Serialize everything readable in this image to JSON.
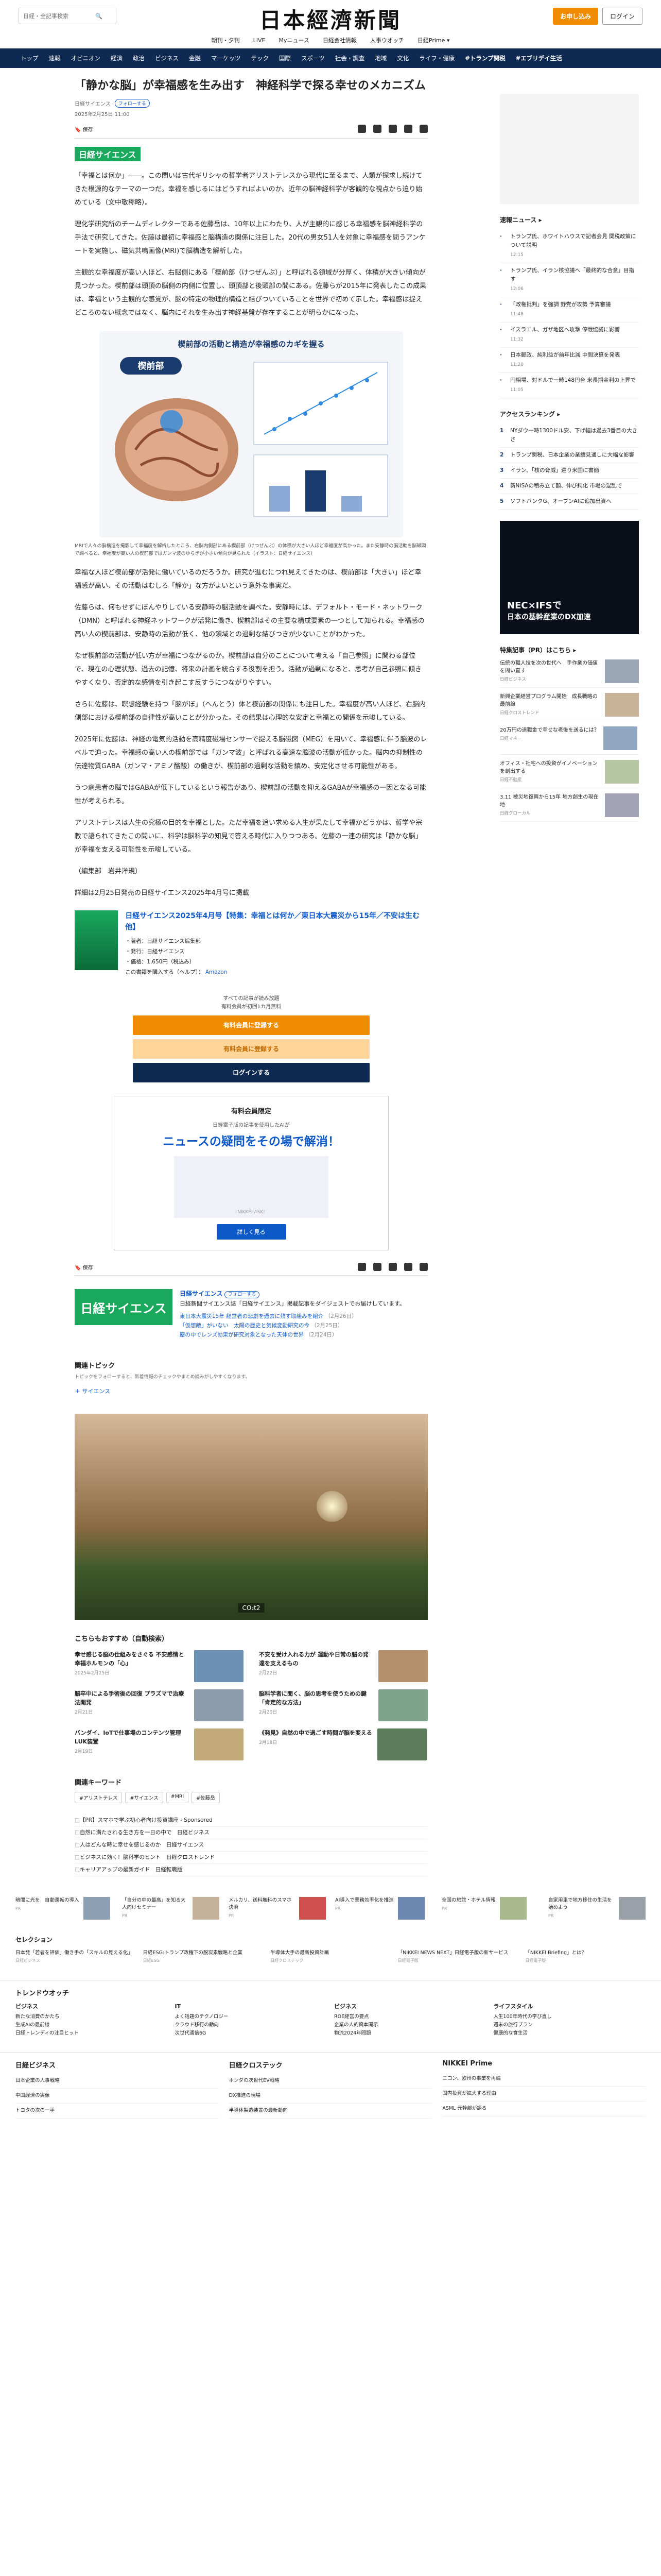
{
  "header": {
    "search_placeholder": "日経・全記事検索",
    "logo": "日本經濟新聞",
    "subscribe_label": "お申し込み",
    "login_label": "ログイン"
  },
  "subnav": [
    "朝刊・夕刊",
    "LIVE",
    "Myニュース",
    "日経会社情報",
    "人事ウオッチ",
    "日経Prime ▾"
  ],
  "mainnav": [
    "トップ",
    "速報",
    "オピニオン",
    "経済",
    "政治",
    "ビジネス",
    "金融",
    "マーケッツ",
    "テック",
    "国際",
    "スポーツ",
    "社会・調査",
    "地域",
    "文化",
    "ライフ・健康",
    "#トランプ関税",
    "#エブリデイ生活"
  ],
  "article": {
    "title": "「静かな脳」が幸福感を生み出す　神経科学で探る幸せのメカニズム",
    "source": "日経サイエンス",
    "follow": "フォローする",
    "date": "2025年2月25日 11:00",
    "save_label": "保存",
    "badge": "日経サイエンス",
    "paragraphs": [
      "「幸福とは何か」――。この問いは古代ギリシャの哲学者アリストテレスから現代に至るまで、人類が探求し続けてきた根源的なテーマの一つだ。幸福を感じるにはどうすればよいのか。近年の脳神経科学が客観的な視点から迫り始めている（文中敬称略）。",
      "理化学研究所のチームディレクターである佐藤岳は、10年以上にわたり、人が主観的に感じる幸福感を脳神経科学の手法で研究してきた。佐藤は最初に幸福感と脳構造の関係に注目した。20代の男女51人を対象に幸福感を問うアンケートを実施し、磁気共鳴画像(MRI)で脳構造を解析した。",
      "主観的な幸福度が高い人ほど、右脳側にある「楔前部（けつぜんぶ）」と呼ばれる領域が分厚く、体積が大きい傾向が見つかった。楔前部は頭頂の脳側の内側に位置し、頭頂部と後頭部の間にある。佐藤らが2015年に発表したこの成果は、幸福という主観的な感覚が、脳の特定の物理的構造と結びついていることを世界で初めて示した。幸福感は捉えどころのない概念ではなく、脳内にそれを生み出す神経基盤が存在することが明らかになった。",
      "幸福な人ほど楔前部が活発に働いているのだろうか。研究が進むにつれ見えてきたのは、楔前部は「大きい」ほど幸福感が高い、その活動はむしろ「静か」な方がよいという意外な事実だ。",
      "佐藤らは、何もせずにぼんやりしている安静時の脳活動を調べた。安静時には、デフォルト・モード・ネットワーク（DMN）と呼ばれる神経ネットワークが活発に働き、楔前部はその主要な構成要素の一つとして知られる。幸福感の高い人の楔前部は、安静時の活動が低く、他の領域との過剰な結びつきが少ないことがわかった。",
      "なぜ楔前部の活動が低い方が幸福につながるのか。楔前部は自分のことについて考える「自己参照」に関わる部位で、現在の心理状態、過去の記憶、将来の計画を統合する役割を担う。活動が過剰になると、思考が自己参照に傾きやすくなり、否定的な感情を引き起こす反すうにつながりやすい。",
      "さらに佐藤は、瞑想経験を持つ「脳がぼ」（へんとう）体と楔前部の関係にも注目した。幸福度が高い人ほど、右脳内側部における楔前部の自律性が高いことが分かった。その結果は心理的な安定と幸福との関係を示唆している。",
      "2025年に佐藤は、神経の電気的活動を高精度磁場センサーで捉える脳磁図（MEG）を用いて、幸福感に伴う脳波のレベルで迫った。幸福感の高い人の楔前部では「ガンマ波」と呼ばれる高速な脳波の活動が低かった。脳内の抑制性の伝達物質GABA（ガンマ・アミノ酪酸）の働きが、楔前部の過剰な活動を鎮め、安定化させる可能性がある。",
      "うつ病患者の脳ではGABAが低下しているという報告があり、楔前部の活動を抑えるGABAが幸福感の一因となる可能性が考えられる。",
      "アリストテレスは人生の究極の目的を幸福とした。ただ幸福を追い求める人生が果たして幸福かどうかは、哲学や宗教で語られてきたこの問いに、科学は脳科学の知見で答える時代に入りつつある。佐藤の一連の研究は「静かな脳」が幸福を支える可能性を示唆している。",
      "（編集部　岩井洋規）"
    ],
    "figure": {
      "title": "楔前部の活動と構造が幸福感のカギを握る",
      "region_label": "楔前部",
      "caption": "MRIで人々の脳構造を撮影して幸福度を解析したところ、右脳内側部にある楔前部（けつぜんぶ）の体積が大きい人ほど幸福度が高かった。また安静時の脳活動を脳磁図で調べると、幸福度が高い人の楔前部ではガンマ波のゆらぎが小さい傾向が見られた（イラスト：日経サイエンス）"
    },
    "detail_link": "詳細は2月25日発売の日経サイエンス2025年4月号に掲載",
    "book": {
      "title": "日経サイエンス2025年4月号【特集：幸福とは何か／東日本大震災から15年／不安は生む他】",
      "lines": [
        "・著者：日経サイエンス編集部",
        "・発行：日経サイエンス",
        "・価格：1,650円（税込み）"
      ],
      "buy": "この書籍を購入する（ヘルプ）：",
      "amazon": "Amazon"
    },
    "paywall": {
      "note1": "すべての記事が読み放題",
      "note2": "有料会員が初回1カ月無料",
      "cta1": "有料会員に登録する",
      "cta2": "有料会員に登録する",
      "cta3": "ログインする"
    },
    "promo": {
      "head": "有料会員限定",
      "sub": "日経電子版の記事を使用したAIが",
      "big": "ニュースの疑問をその場で解消！",
      "img_label": "NIKKEI ASK!",
      "more": "詳しく見る"
    }
  },
  "source_block": {
    "name": "日経サイエンス",
    "follow": "フォローする",
    "desc": "日経新聞サイエンス誌「日経サイエンス」掲載記事をダイジェストでお届けしています。",
    "items": [
      {
        "text": "東日本大震災15年 経営者の悲劇を過去に残す取組みを紹介",
        "date": "（2月26日）"
      },
      {
        "text": "「仮想敵」がいない　太陽の歴史と気候変動研究の今",
        "date": "（2月25日）"
      },
      {
        "text": "塵の中でレンズ効果が研究対象となった天体の世界",
        "date": "（2月24日）"
      }
    ]
  },
  "topic": {
    "title": "関連トピック",
    "sub": "トピックをフォローすると、新着情報のチェックやまとめ読みがしやすくなります。",
    "chip": "＋ サイエンス"
  },
  "video": {
    "caption": "CO₂t2"
  },
  "reco": {
    "title": "こちらもおすすめ（自動検索）",
    "items": [
      {
        "t": "幸せ感じる脳の仕組みをさぐる 不安感情と幸福ホルモンの「心」",
        "s": "2025年2月25日"
      },
      {
        "t": "不安を受け入れる力が 運動や日常の脳の発達を支えるもの",
        "s": "2月22日"
      },
      {
        "t": "脳卒中による手術後の回復 プラズマで治療法開発",
        "s": "2月21日"
      },
      {
        "t": "脳科学者に聞く、脳の思考を使うための鍵「肯定的な方法」",
        "s": "2月20日"
      },
      {
        "t": "バンダイ、IoTで仕事場のコンテンツ管理 LUK装置",
        "s": "2月19日"
      },
      {
        "t": "《発見》自然の中で過ごす時間が脳を変える",
        "s": "2月18日"
      }
    ]
  },
  "keywords": {
    "title": "関連キーワード",
    "chips": [
      "#アリストテレス",
      "#サイエンス",
      "#MRI",
      "#佐藤岳"
    ]
  },
  "pr_list": [
    "【PR】スマホで学ぶ初心者向け投資講座 - Sponsored",
    "自然に満たされる生き方を一日の中で　日経ビジネス",
    "人はどんな時に幸せを感じるのか　日経サイエンス",
    "ビジネスに効く！脳科学のヒント　日経クロストレンド",
    "キャリアアップの最新ガイド　日経転職版"
  ],
  "sidebar": {
    "news_title": "速報ニュース ▸",
    "news": [
      {
        "t": "トランプ氏、ホワイトハウスで記者会見 関税政策について説明",
        "tm": "12:15"
      },
      {
        "t": "トランプ氏、イラン核協議へ「最終的な合意」目指す",
        "tm": "12:06"
      },
      {
        "t": "「政権批判」を強調 野党が攻勢 予算審議",
        "tm": "11:48"
      },
      {
        "t": "イスラエル、ガザ地区へ攻撃 停戦協議に影響",
        "tm": "11:32"
      },
      {
        "t": "日本郵政、純利益が前年比減 中間決算を発表",
        "tm": "11:20"
      },
      {
        "t": "円相場、対ドルで一時148円台 米長期金利の上昇で",
        "tm": "11:05"
      }
    ],
    "access_title": "アクセスランキング ▸",
    "access": [
      {
        "t": "NYダウ一時1300ドル安、下げ幅は過去3番目の大きさ"
      },
      {
        "t": "トランプ関税、日本企業の業績見通しに大幅な影響"
      },
      {
        "t": "イラン、「核の脅威」巡り米国に書簡"
      },
      {
        "t": "新NISAの積み立て額、伸び鈍化 市場の混乱で"
      },
      {
        "t": "ソフトバンクG、オープンAIに追加出資へ"
      }
    ],
    "ad_title": "NEC×IFSで",
    "ad_sub": "日本の基幹産業のDX加速",
    "special_title": "特集記事（PR）はこちら ▸",
    "specials": [
      {
        "t": "伝統の職人技を次の世代へ　手作業の価値を問い直す",
        "s": "日経ビジネス"
      },
      {
        "t": "新興企業経営プログラム開始　成長戦略の最前線",
        "s": "日経クロストレンド"
      },
      {
        "t": "20万円の退職金で幸せな老後を送るには？",
        "s": "日経マネー"
      },
      {
        "t": "オフィス・社宅への投資がイノベーションを創出する",
        "s": "日経不動産"
      },
      {
        "t": "3.11 被災地復興から15年 地方創生の現在地",
        "s": "日経グローカル"
      }
    ]
  },
  "pr_strip": [
    {
      "t": "暗闇に光を　自動運転の導入",
      "s": "PR"
    },
    {
      "t": "「自分の中の最高」を知る大人向けセミナー",
      "s": "PR"
    },
    {
      "t": "メルカリ、送料無料のスマホ決済",
      "s": "PR"
    },
    {
      "t": "AI導入で業務効率化を推進",
      "s": "PR"
    },
    {
      "t": "全国の旅館・ホテル情報",
      "s": "PR"
    },
    {
      "t": "自家用車で地方移住の生活を始めよう",
      "s": "PR"
    }
  ],
  "selection": {
    "title": "セレクション",
    "items": [
      {
        "t": "日本発「若者を評価」働き手の「スキルの見える化」",
        "s": "日経ビジネス"
      },
      {
        "t": "日経ESG:トランプ政権下の脱炭素戦略と企業",
        "s": "日経ESG"
      },
      {
        "t": "半導体大手の最新投資計画",
        "s": "日経クロステック"
      },
      {
        "t": "「NIKKEI NEWS NEXT」日経電子版の新サービス",
        "s": "日経電子版"
      },
      {
        "t": "「NIKKEI Briefing」とは？",
        "s": "日経電子版"
      }
    ]
  },
  "trend": {
    "title": "トレンドウオッチ",
    "cols": [
      {
        "h": "ビジネス",
        "items": [
          "新たな消費のかたち",
          "生成AIの最前線",
          "日経トレンディの注目ヒット"
        ]
      },
      {
        "h": "IT",
        "items": [
          "よく話題のテクノロジー",
          "クラウド移行の動向",
          "次世代通信6G"
        ]
      },
      {
        "h": "ビジネス",
        "items": [
          "ROE経営の要点",
          "企業の人的資本開示",
          "物流2024年問題"
        ]
      },
      {
        "h": "ライフスタイル",
        "items": [
          "人生100年時代の学び直し",
          "週末の旅行プラン",
          "健康的な食生活"
        ]
      }
    ]
  },
  "brands": [
    {
      "h": "日経ビジネス",
      "items": [
        "日本企業の人事戦略",
        "中国経済の実像",
        "トヨタの次の一手"
      ]
    },
    {
      "h": "日経クロステック",
      "items": [
        "ホンダの次世代EV戦略",
        "DX推進の現場",
        "半導体製造装置の最新動向"
      ]
    },
    {
      "h": "NIKKEI Prime",
      "items": [
        "ニコン、欧州の事業を再編",
        "国内投資が拡大する理由",
        "ASML 元幹部が語る"
      ]
    }
  ]
}
